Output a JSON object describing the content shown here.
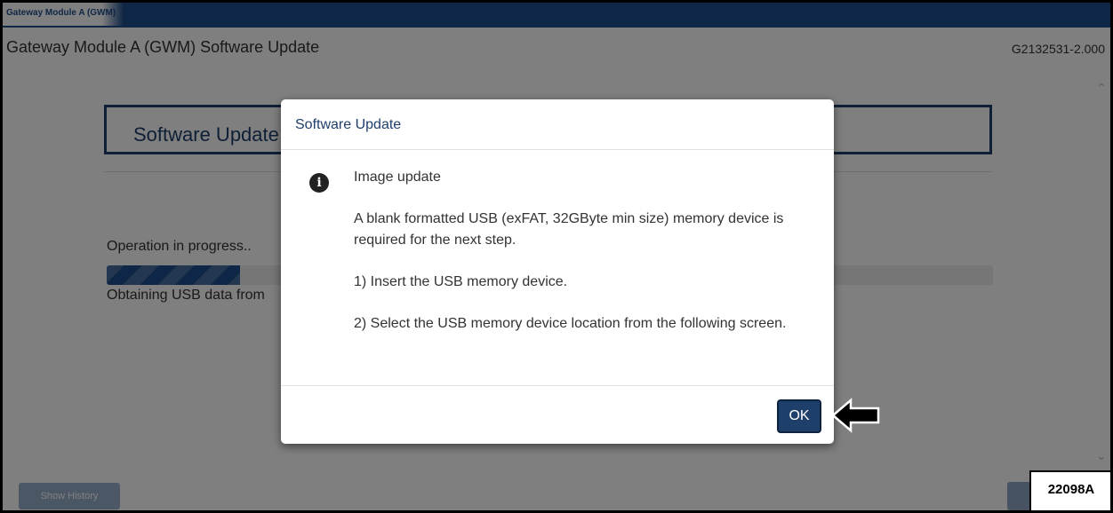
{
  "tab": {
    "label": "Gateway Module A (GWM)"
  },
  "header": {
    "title": "Gateway Module A (GWM) Software Update",
    "version": "G2132531-2.000"
  },
  "panel": {
    "title": "Software Update",
    "operation_text": "Operation in progress..",
    "progress_fraction": 0.15,
    "status_text": "Obtaining USB data from"
  },
  "footer": {
    "show_history_label": "Show History",
    "figure_label": "22098A"
  },
  "modal": {
    "title": "Software Update",
    "heading": "Image update",
    "paragraph1": "A blank formatted USB (exFAT, 32GByte min size) memory device is required for the next step.",
    "step1": "1) Insert the USB memory device.",
    "step2": "2) Select the USB memory device location from the following screen.",
    "ok_label": "OK",
    "icon": "info-icon"
  },
  "colors": {
    "accent": "#1f4e8c",
    "dark_accent": "#1f3f6b"
  }
}
